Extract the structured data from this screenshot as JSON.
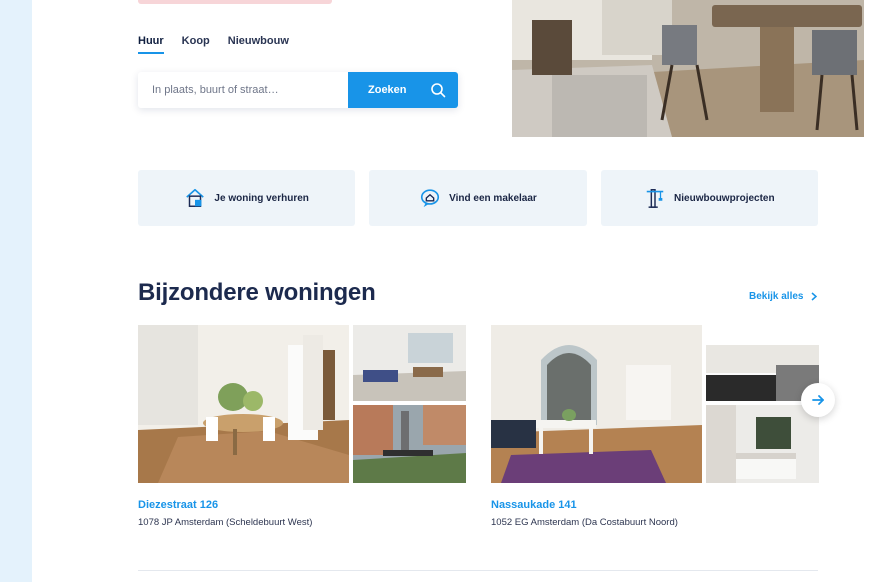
{
  "search_tabs": {
    "rent": "Huur",
    "buy": "Koop",
    "new_build": "Nieuwbouw"
  },
  "search": {
    "placeholder": "In plaats, buurt of straat…",
    "button_label": "Zoeken"
  },
  "quick_links": [
    {
      "label": "Je woning verhuren",
      "icon": "house-rent-icon"
    },
    {
      "label": "Vind een makelaar",
      "icon": "agent-search-icon"
    },
    {
      "label": "Nieuwbouwprojecten",
      "icon": "crane-icon"
    }
  ],
  "section": {
    "title": "Bijzondere woningen",
    "see_all": "Bekijk alles"
  },
  "listings": [
    {
      "title": "Diezestraat 126",
      "subtitle": "1078 JP Amsterdam (Scheldebuurt West)"
    },
    {
      "title": "Nassaukade 141",
      "subtitle": "1052 EG Amsterdam (Da Costabuurt Noord)"
    }
  ],
  "colors": {
    "accent": "#1894e8",
    "heading": "#1c2a4e",
    "card_bg": "#eef4f9"
  }
}
